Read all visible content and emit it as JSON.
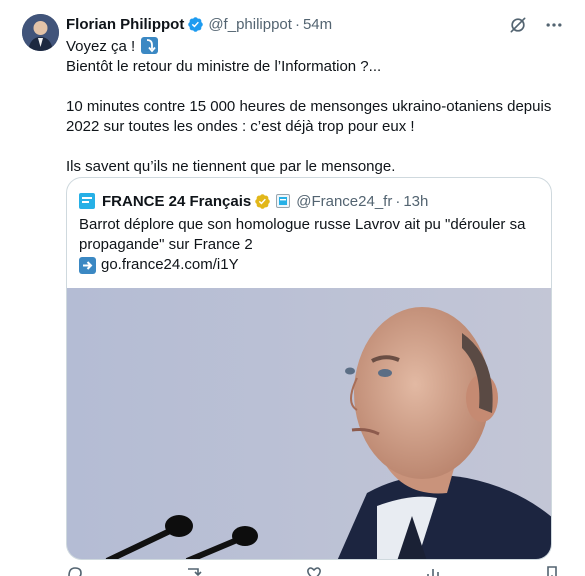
{
  "author": {
    "name": "Florian Philippot",
    "handle": "@f_philippot",
    "dot": "·",
    "time": "54m"
  },
  "post": {
    "line1": "Voyez ça !",
    "line2": "Bientôt le retour du ministre de l’Information ?...",
    "line3": "10 minutes contre 15 000 heures de mensonges ukraino-otaniens depuis 2022 sur toutes les ondes : c’est déjà trop pour eux !",
    "line4": "Ils savent qu’ils ne tiennent que par le mensonge."
  },
  "quote": {
    "name": "FRANCE 24 Français",
    "handle": "@France24_fr",
    "dot": "·",
    "time": "13h",
    "text": "Barrot déplore que son homologue russe Lavrov ait pu \"dérouler sa propagande\" sur France 2",
    "link": "go.france24.com/i1Y"
  },
  "icons": {
    "verified": "verified-badge-icon",
    "grok": "grok-icon",
    "more": "more-icon",
    "arrow": "right-arrow-emoji-icon",
    "down_arrow": "curved-down-arrow-emoji-icon"
  },
  "colors": {
    "verified_blue": "#1d9bf0",
    "gold": "#e2b719",
    "secondary_text": "#536471",
    "border": "#cfd9de"
  }
}
